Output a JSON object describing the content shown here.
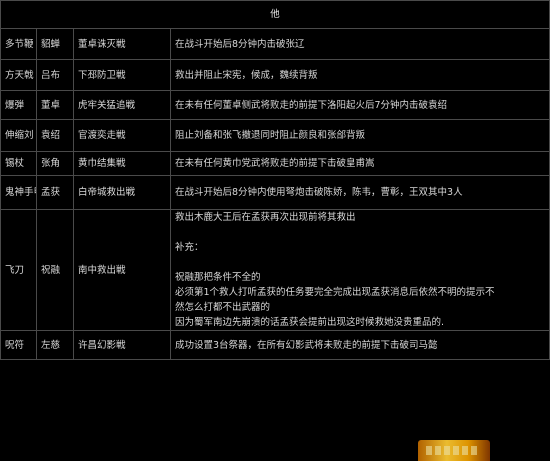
{
  "header": {
    "title": "他"
  },
  "rows": [
    {
      "weapon": "多节鞭",
      "person": "貂蝉",
      "battle": "董卓诛灭戦",
      "desc": [
        "在战斗开始后8分钟内击破张辽"
      ]
    },
    {
      "weapon": "方天戟",
      "person": "吕布",
      "battle": "下邳防卫戦",
      "desc": [
        "救出并阻止宋宪，候成，魏续背叛"
      ]
    },
    {
      "weapon": "爆弾",
      "person": "董卓",
      "battle": "虎牢关猛追戦",
      "desc": [
        "在未有任何董卓侧武将败走的前提下洛阳起火后7分钟内击破袁绍"
      ]
    },
    {
      "weapon": "伸缩刘",
      "person": "袁绍",
      "battle": "官渡奕走戦",
      "desc": [
        "阻止刘备和张飞撤退同时阻止颜良和张郃背叛"
      ]
    },
    {
      "weapon": "锡杖",
      "person": "张角",
      "battle": "黄巾结集戦",
      "desc": [
        "在未有任何黄巾党武将败走的前提下击破皇甫嵩"
      ]
    },
    {
      "weapon": "鬼神手甲",
      "person": "孟获",
      "battle": "白帝城救出戦",
      "desc": [
        "在战斗开始后8分钟内使用弩炮击破陈娇，陈韦，曹彰，王双其中3人"
      ]
    },
    {
      "weapon": "飞刀",
      "person": "祝融",
      "battle": "南中救出戦",
      "desc": [
        "救出木鹿大王后在孟获再次出现前将其救出",
        "",
        "补充：",
        "",
        "祝融那把条件不全的",
        "必须第1个救人打听孟获的任务要完全完成出现孟获消息后依然不明的提示不",
        "然怎么打都不出武器的",
        "因为蜀军南边先崩溃的话孟获会提前出现这时候救她没贵重品的."
      ]
    },
    {
      "weapon": "呪符",
      "person": "左慈",
      "battle": "许昌幻影戦",
      "desc": [
        "成功设置3台祭器，在所有幻影武将未败走的前提下击破司马懿"
      ]
    }
  ],
  "colors": {
    "background": "#000000",
    "border": "#4a4a4a",
    "text": "#d8d8d8",
    "watermark": "#f0a000"
  },
  "icons": {
    "watermark": "site-watermark-logo"
  }
}
